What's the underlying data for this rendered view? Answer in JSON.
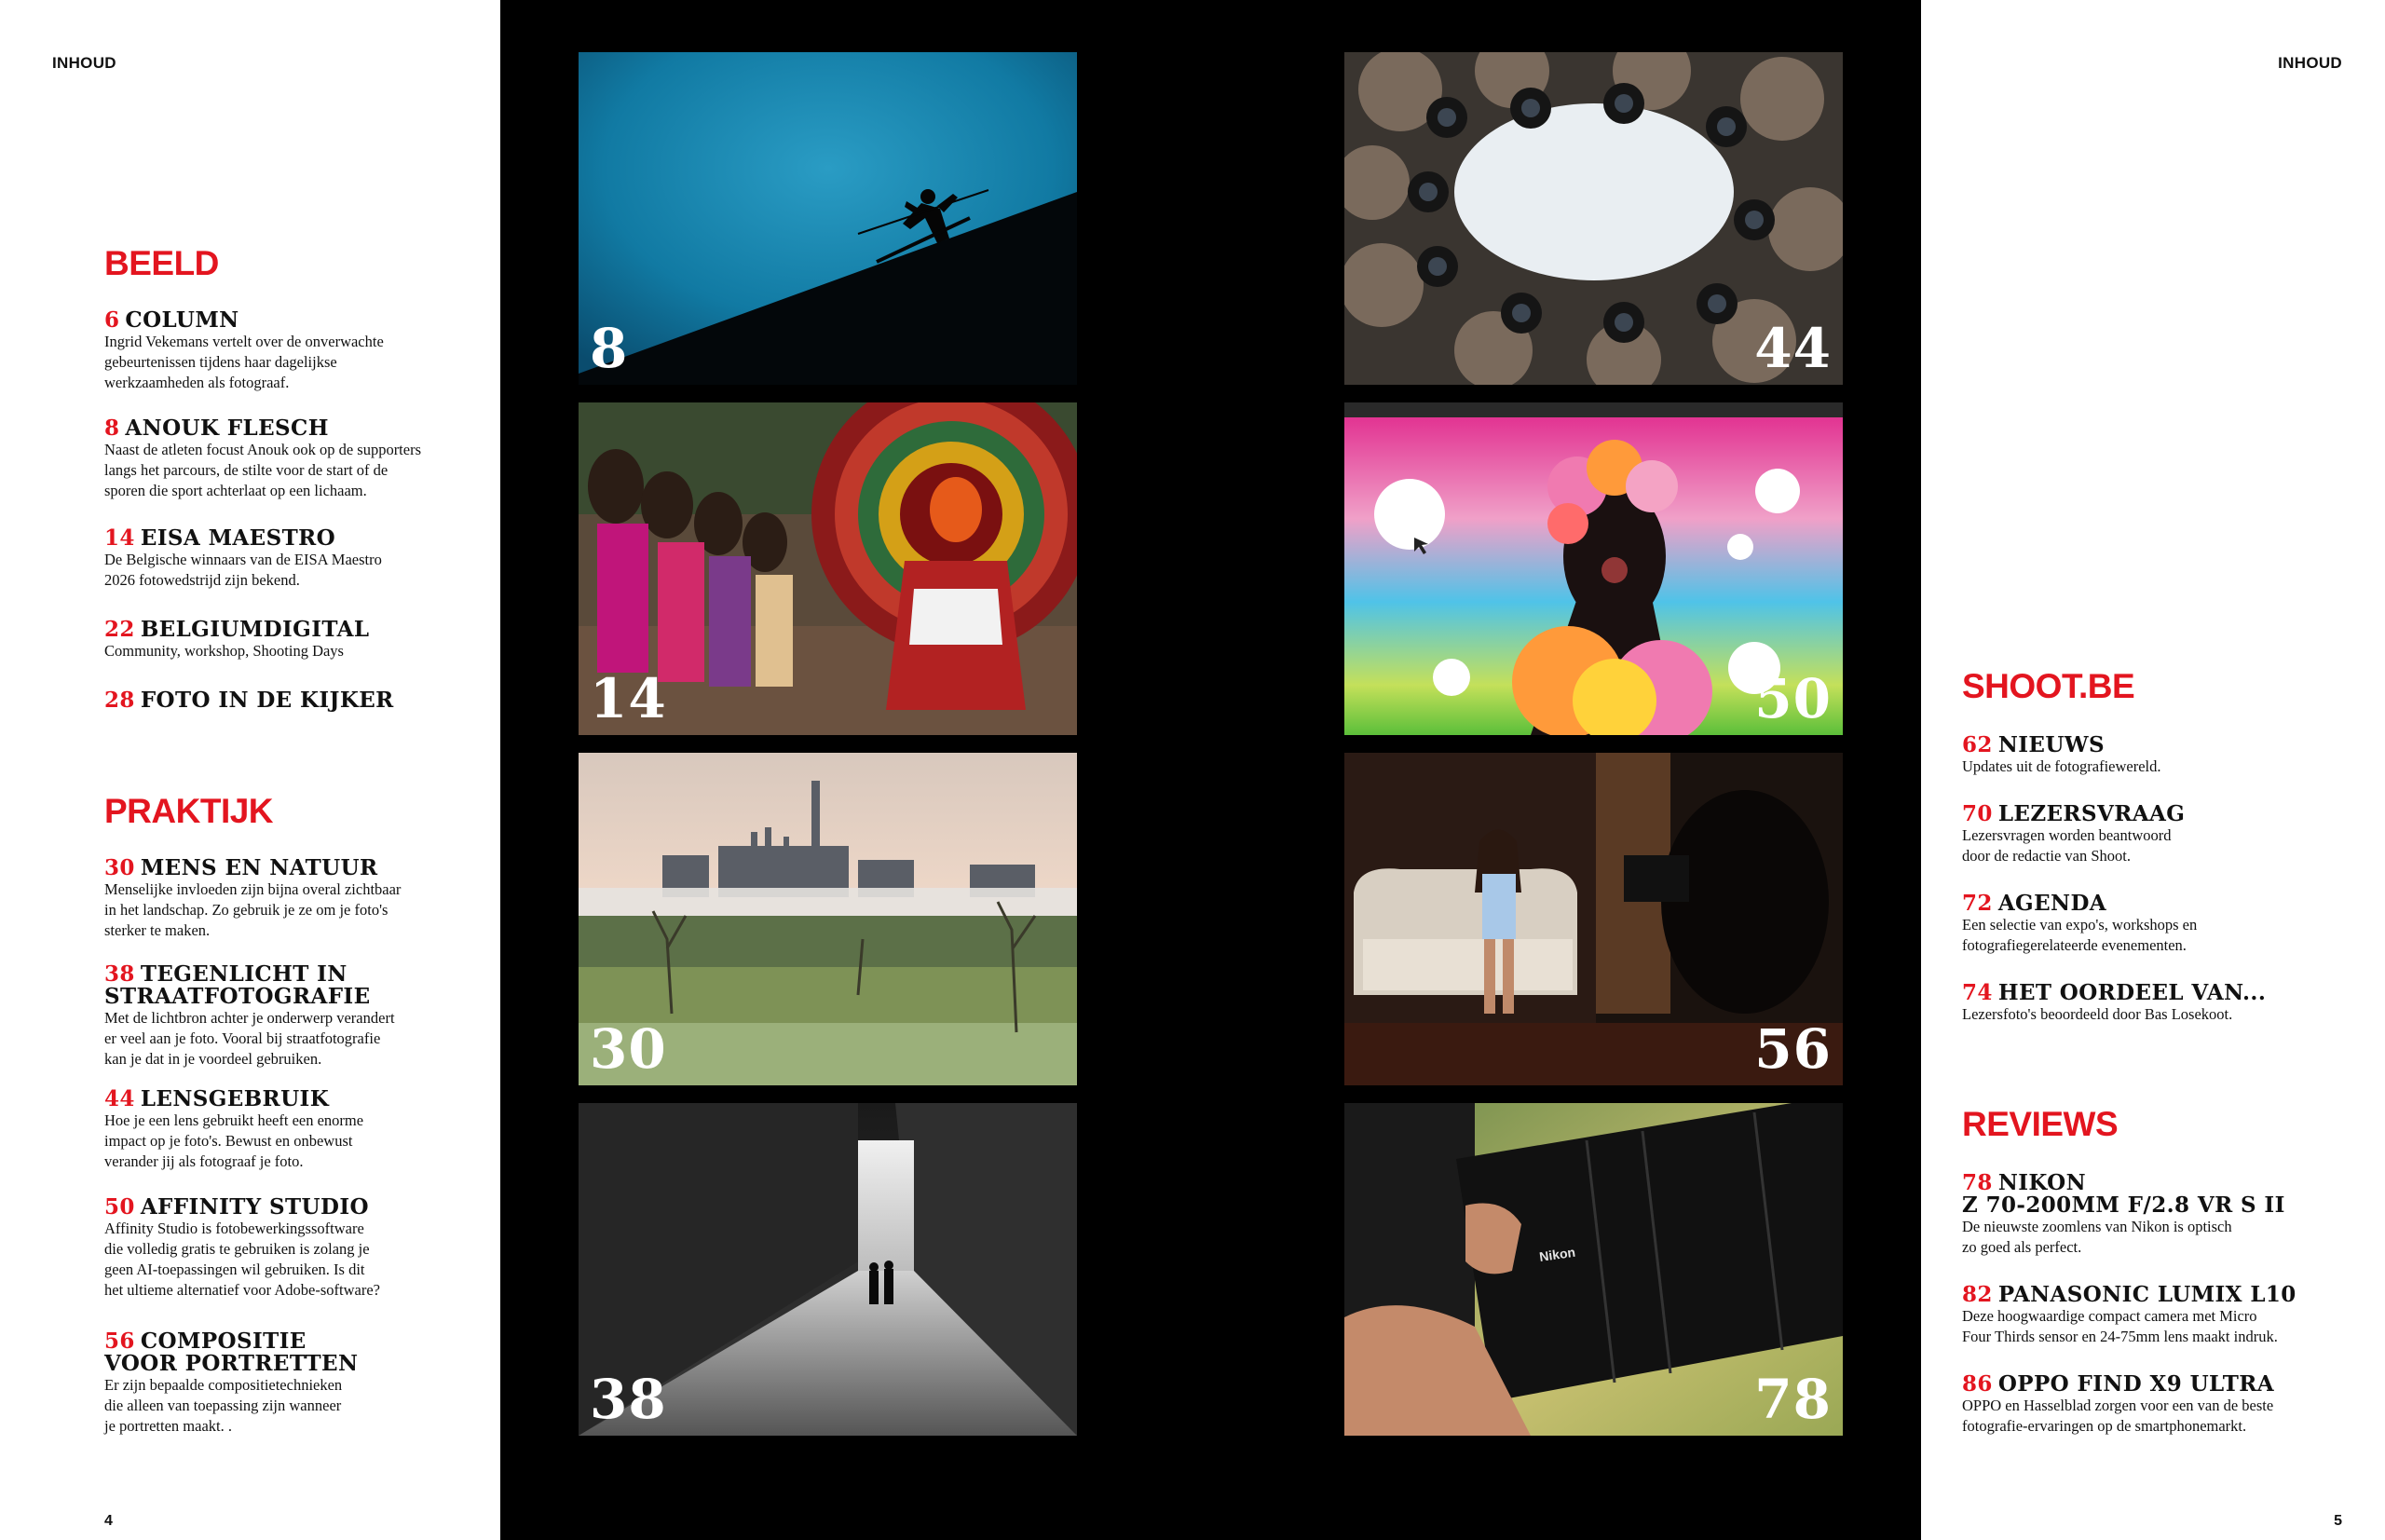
{
  "running_heads": {
    "left": "INHOUD",
    "right": "INHOUD"
  },
  "page_numbers": {
    "left": "4",
    "right": "5"
  },
  "sections": {
    "beeld": "BEELD",
    "praktijk": "PRAKTIJK",
    "shoot": "SHOOT.BE",
    "reviews": "REVIEWS"
  },
  "beeld_items": [
    {
      "num": "6",
      "title": "COLUMN",
      "desc": [
        "Ingrid Vekemans vertelt over de onverwachte",
        "gebeurtenissen tijdens haar dagelijkse",
        "werkzaamheden als fotograaf."
      ]
    },
    {
      "num": "8",
      "title": "ANOUK FLESCH",
      "desc": [
        "Naast de atleten focust Anouk ook op de supporters",
        "langs het parcours, de stilte voor de start of de",
        "sporen die sport achterlaat op een lichaam."
      ]
    },
    {
      "num": "14",
      "title": "EISA MAESTRO",
      "desc": [
        "De Belgische winnaars van de EISA Maestro",
        "2026 fotowedstrijd zijn bekend."
      ]
    },
    {
      "num": "22",
      "title": "BELGIUMDIGITAL",
      "desc": [
        "Community, workshop, Shooting Days"
      ]
    },
    {
      "num": "28",
      "title": "FOTO IN DE KIJKER",
      "desc": []
    }
  ],
  "praktijk_items": [
    {
      "num": "30",
      "title": "MENS EN NATUUR",
      "title2": "",
      "desc": [
        "Menselijke invloeden zijn bijna overal zichtbaar",
        "in het landschap. Zo gebruik je ze om je foto's",
        "sterker te maken."
      ]
    },
    {
      "num": "38",
      "title": "TEGENLICHT IN",
      "title2": "STRAATFOTOGRAFIE",
      "desc": [
        "Met de lichtbron achter je onderwerp verandert",
        "er veel aan je foto. Vooral bij straatfotografie",
        "kan je dat in je voordeel gebruiken."
      ]
    },
    {
      "num": "44",
      "title": "LENSGEBRUIK",
      "title2": "",
      "desc": [
        "Hoe je een lens gebruikt heeft een enorme",
        "impact op je foto's. Bewust en onbewust",
        "verander jij als fotograaf je foto."
      ]
    },
    {
      "num": "50",
      "title": "AFFINITY STUDIO",
      "title2": "",
      "desc": [
        "Affinity Studio is fotobewerkingssoftware",
        "die volledig gratis te gebruiken is zolang je",
        "geen AI-toepassingen wil gebruiken. Is dit",
        "het ultieme alternatief voor Adobe-software?"
      ]
    },
    {
      "num": "56",
      "title": "COMPOSITIE",
      "title2": "VOOR PORTRETTEN",
      "desc": [
        "Er zijn bepaalde compositietechnieken",
        "die alleen van toepassing zijn wanneer",
        "je portretten maakt. ."
      ]
    }
  ],
  "shoot_items": [
    {
      "num": "62",
      "title": "NIEUWS",
      "title2": "",
      "desc": [
        "Updates uit de fotografiewereld."
      ]
    },
    {
      "num": "70",
      "title": "LEZERSVRAAG",
      "title2": "",
      "desc": [
        "Lezersvragen worden beantwoord",
        "door de redactie van Shoot."
      ]
    },
    {
      "num": "72",
      "title": "AGENDA",
      "title2": "",
      "desc": [
        "Een selectie van expo's, workshops en",
        "fotografiegerelateerde evenementen."
      ]
    },
    {
      "num": "74",
      "title": "HET OORDEEL VAN...",
      "title2": "",
      "desc": [
        "Lezersfoto's beoordeeld door Bas Losekoot."
      ]
    }
  ],
  "review_items": [
    {
      "num": "78",
      "title": "NIKON",
      "title2": "Z 70-200MM F/2.8 VR S II",
      "desc": [
        "De nieuwste zoomlens van Nikon is optisch",
        "zo goed als perfect."
      ]
    },
    {
      "num": "82",
      "title": "PANASONIC LUMIX L10",
      "title2": "",
      "desc": [
        "Deze hoogwaardige compact camera met Micro",
        "Four Thirds sensor en 24-75mm lens maakt indruk."
      ]
    },
    {
      "num": "86",
      "title": "OPPO FIND X9 ULTRA",
      "title2": "",
      "desc": [
        "OPPO en Hasselblad zorgen voor een van de beste",
        "fotografie-ervaringen op de smartphonemarkt."
      ]
    }
  ],
  "photos": [
    {
      "page": "8",
      "subject": "skier-silhouette-blue-sky"
    },
    {
      "page": "14",
      "subject": "theyyam-performer-crowd"
    },
    {
      "page": "30",
      "subject": "industrial-landscape-misty-field"
    },
    {
      "page": "38",
      "subject": "black-white-alley-backlit"
    },
    {
      "page": "44",
      "subject": "photographers-circle-from-below"
    },
    {
      "page": "50",
      "subject": "affinity-studio-colorful-portrait"
    },
    {
      "page": "56",
      "subject": "photographer-shooting-woman-on-sofa"
    },
    {
      "page": "78",
      "subject": "nikon-telephoto-zoom-lens"
    }
  ],
  "colors": {
    "accent": "#e3151f",
    "spread_background": "#000000",
    "page_background": "#ffffff"
  }
}
